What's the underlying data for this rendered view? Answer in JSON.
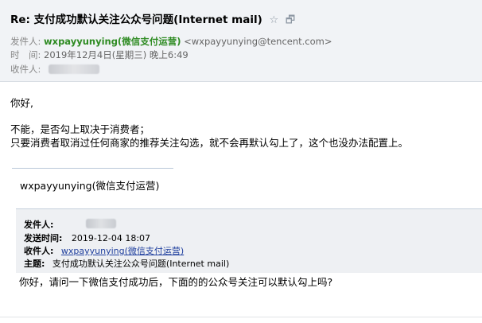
{
  "header": {
    "subject": "Re: 支付成功默认关注公众号问题(Internet mail)",
    "star_icon": "☆",
    "window_icon": "🗗",
    "from_label": "发件人:",
    "from_name": "wxpayyunying(微信支付运营)",
    "from_email": "<wxpayyunying@tencent.com>",
    "time_label": "时　间:",
    "time_value": "2019年12月4日(星期三) 晚上6:49",
    "to_label": "收件人:"
  },
  "body": {
    "greeting": "你好,",
    "line1": "不能，是否勾上取决于消费者；",
    "line2": "只要消费者取消过任何商家的推荐关注勾选，就不会再默认勾上了，这个也没办法配置上。",
    "signature": "wxpayyunying(微信支付运营)"
  },
  "quote": {
    "from_label": "发件人:",
    "sent_label": "发送时间:",
    "sent_value": "2019-12-04 18:07",
    "to_label": "收件人:",
    "to_value": "wxpayyunying(微信支付运营)",
    "subject_label": "主题:",
    "subject_value": "支付成功默认关注公众号问题(Internet mail)",
    "question": "你好，请问一下微信支付成功后，下面的的公众号关注可以默认勾上吗?"
  }
}
